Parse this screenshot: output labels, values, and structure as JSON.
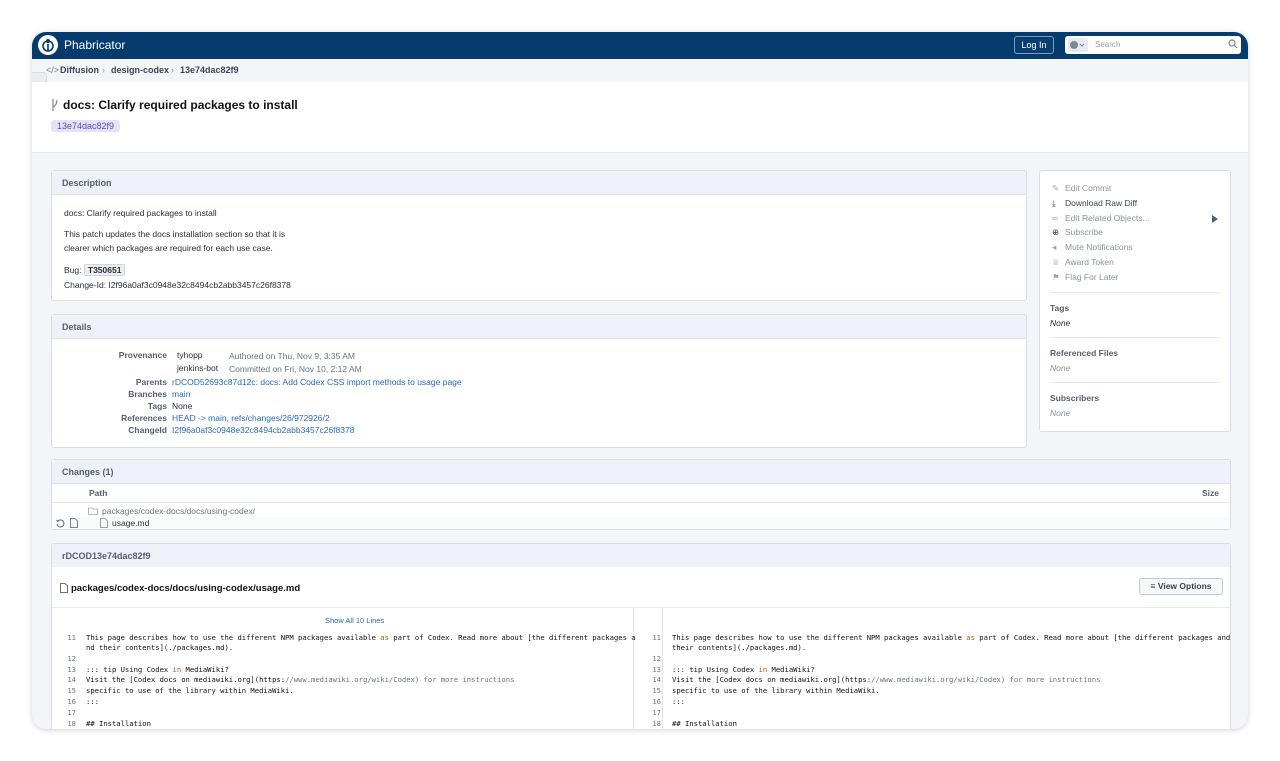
{
  "app": {
    "name": "Phabricator",
    "login_label": "Log In",
    "search_placeholder": "Search"
  },
  "breadcrumb": {
    "items": [
      "Diffusion",
      "design-codex",
      "13e74dac82f9"
    ]
  },
  "commit": {
    "title": "docs: Clarify required packages to install",
    "hash": "13e74dac82f9"
  },
  "description": {
    "header": "Description",
    "summary": "docs: Clarify required packages to install",
    "body_line1": "This patch updates the docs installation section so that it is",
    "body_line2": "clearer which packages are required for each use case.",
    "bug_label": "Bug:",
    "bug_value": "T350651",
    "change_id_line": "Change-Id: I2f96a0af3c0948e32c8494cb2abb3457c26f8378"
  },
  "details": {
    "header": "Details",
    "provenance_label": "Provenance",
    "author": "tyhopp",
    "authored": "Authored on Thu, Nov 9, 3:35 AM",
    "committer": "jenkins-bot",
    "committed": "Committed on Fri, Nov 10, 2:12 AM",
    "parents_label": "Parents",
    "parents_value": "rDCOD52693c87d12c: docs: Add Codex CSS import methods to usage page",
    "branches_label": "Branches",
    "branches_value": "main",
    "tags_label": "Tags",
    "tags_value": "None",
    "references_label": "References",
    "references_value": "HEAD -> main, refs/changes/26/972926/2",
    "changeid_label": "ChangeId",
    "changeid_value": "I2f96a0af3c0948e32c8494cb2abb3457c26f8378"
  },
  "actions": [
    {
      "label": "Edit Commit",
      "icon": "pencil-icon"
    },
    {
      "label": "Download Raw Diff",
      "icon": "download-icon"
    },
    {
      "label": "Edit Related Objects...",
      "icon": "link-icon"
    },
    {
      "label": "Subscribe",
      "icon": "plus-circle-icon"
    },
    {
      "label": "Mute Notifications",
      "icon": "volume-icon"
    },
    {
      "label": "Award Token",
      "icon": "trophy-icon"
    },
    {
      "label": "Flag For Later",
      "icon": "flag-icon"
    }
  ],
  "sidebar": {
    "tags_label": "Tags",
    "tags_value": "None",
    "files_label": "Referenced Files",
    "files_value": "None",
    "subscribers_label": "Subscribers",
    "subscribers_value": "None"
  },
  "changes": {
    "header": "Changes (1)",
    "col_path": "Path",
    "col_size": "Size",
    "folder": "packages/codex-docs/docs/using-codex/",
    "file": "usage.md"
  },
  "diff": {
    "header": "rDCOD13e74dac82f9",
    "file_path": "packages/codex-docs/docs/using-codex/usage.md",
    "view_options": "View Options",
    "show_all": "Show All 10 Lines"
  }
}
